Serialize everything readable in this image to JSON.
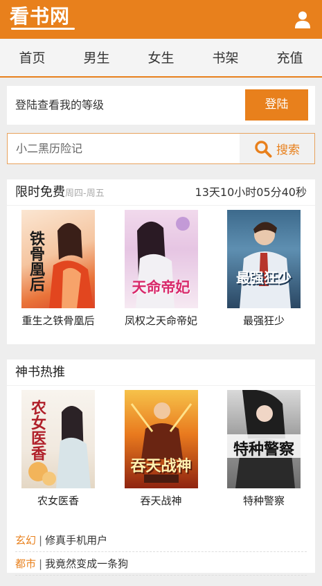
{
  "header": {
    "logo": "看书网"
  },
  "nav": {
    "items": [
      {
        "label": "首页"
      },
      {
        "label": "男生"
      },
      {
        "label": "女生"
      },
      {
        "label": "书架"
      },
      {
        "label": "充值"
      }
    ]
  },
  "login": {
    "text": "登陆查看我的等级",
    "button": "登陆"
  },
  "search": {
    "placeholder": "小二黑历险记",
    "button": "搜索"
  },
  "free_section": {
    "title": "限时免费",
    "subtitle": "周四-周五",
    "countdown": "13天10小时05分40秒",
    "books": [
      {
        "title": "重生之铁骨凰后",
        "cover_text": "铁骨凰后"
      },
      {
        "title": "凤权之天命帝妃",
        "cover_text": "天命帝妃"
      },
      {
        "title": "最强狂少",
        "cover_text": "最强狂少"
      }
    ]
  },
  "hot_section": {
    "title": "神书热推",
    "books": [
      {
        "title": "农女医香",
        "cover_text": "农女医香"
      },
      {
        "title": "吞天战神",
        "cover_text": "吞天战神"
      },
      {
        "title": "特种警察",
        "cover_text": "特种警察"
      }
    ],
    "list": [
      {
        "category": "玄幻",
        "separator": "|",
        "title": "修真手机用户"
      },
      {
        "category": "都市",
        "separator": "|",
        "title": "我竟然变成一条狗"
      }
    ]
  }
}
